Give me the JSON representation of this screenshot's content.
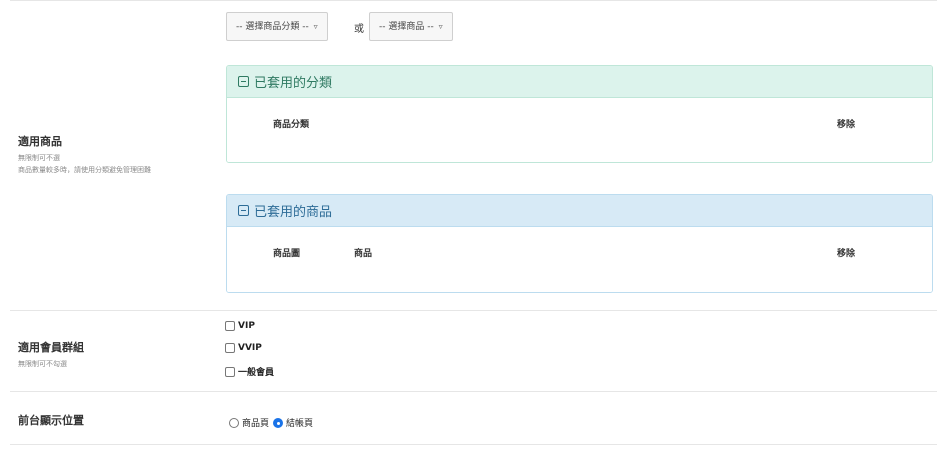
{
  "products_section": {
    "category_select": "-- 選擇商品分類 --",
    "or_text": "或",
    "product_select": "-- 選擇商品 --",
    "label_title": "適用商品",
    "label_sub1": "無限制可不選",
    "label_sub2": "商品數量較多時，請使用分類避免管理困難",
    "applied_categories": {
      "title": "已套用的分類",
      "col_category": "商品分類",
      "col_remove": "移除"
    },
    "applied_products": {
      "title": "已套用的商品",
      "col_image": "商品圖",
      "col_product": "商品",
      "col_remove": "移除"
    }
  },
  "member_groups": {
    "label_title": "適用會員群組",
    "label_sub": "無限制可不勾選",
    "options": [
      {
        "label": "VIP",
        "checked": false
      },
      {
        "label": "VVIP",
        "checked": false
      },
      {
        "label": "一般會員",
        "checked": false
      }
    ]
  },
  "display_position": {
    "label_title": "前台顯示位置",
    "options": [
      {
        "label": "商品頁",
        "selected": false
      },
      {
        "label": "結帳頁",
        "selected": true
      }
    ]
  },
  "colors": {
    "green_panel": "#dcf3ec",
    "blue_panel": "#d7eaf6",
    "radio_accent": "#1a73e8"
  }
}
